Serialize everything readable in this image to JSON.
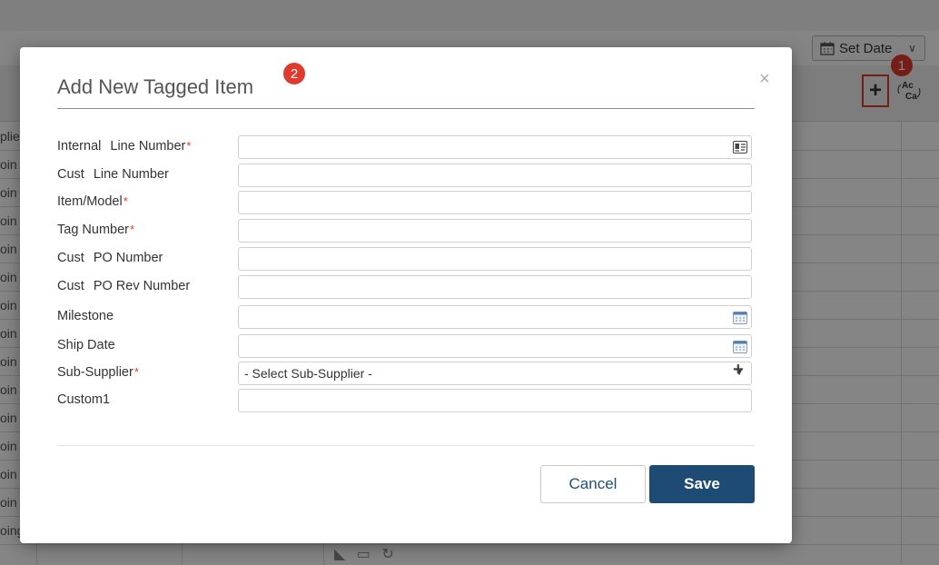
{
  "background": {
    "set_date_label": "Set Date",
    "left_column_fragments": [
      "plie",
      "oin",
      "oin",
      "oin",
      "oin",
      "oin",
      "oin",
      "oin",
      "oin",
      "oin",
      "oin",
      "oin",
      "oin",
      "oin",
      "oing"
    ],
    "step_markers": [
      "1"
    ]
  },
  "modal": {
    "title": "Add New Tagged Item",
    "title_marker": "2",
    "close_symbol": "×",
    "fields": [
      {
        "prefix": "Internal",
        "label": "Line Number",
        "required": true,
        "icon": "contact-card-icon"
      },
      {
        "prefix": "Cust",
        "label": "Line Number",
        "required": false,
        "icon": ""
      },
      {
        "prefix": "",
        "label": "Item/Model",
        "required": true,
        "icon": ""
      },
      {
        "prefix": "",
        "label": "Tag Number",
        "required": true,
        "icon": ""
      },
      {
        "prefix": "Cust",
        "label": "PO Number",
        "required": false,
        "icon": ""
      },
      {
        "prefix": "Cust",
        "label": "PO Rev Number",
        "required": false,
        "icon": ""
      },
      {
        "prefix": "",
        "label": "Milestone",
        "required": false,
        "icon": "calendar-icon"
      },
      {
        "prefix": "",
        "label": "Ship Date",
        "required": false,
        "icon": "calendar-icon"
      },
      {
        "prefix": "",
        "label": "Sub-Supplier",
        "required": true,
        "icon": "",
        "select_value": "- Select Sub-Supplier -"
      },
      {
        "prefix": "",
        "label": "Custom1",
        "required": false,
        "icon": ""
      }
    ],
    "required_mark": "*",
    "cancel_label": "Cancel",
    "save_label": "Save"
  },
  "colors": {
    "accent": "#1e4b73",
    "marker": "#e03a2f",
    "required": "#e03a2f"
  }
}
